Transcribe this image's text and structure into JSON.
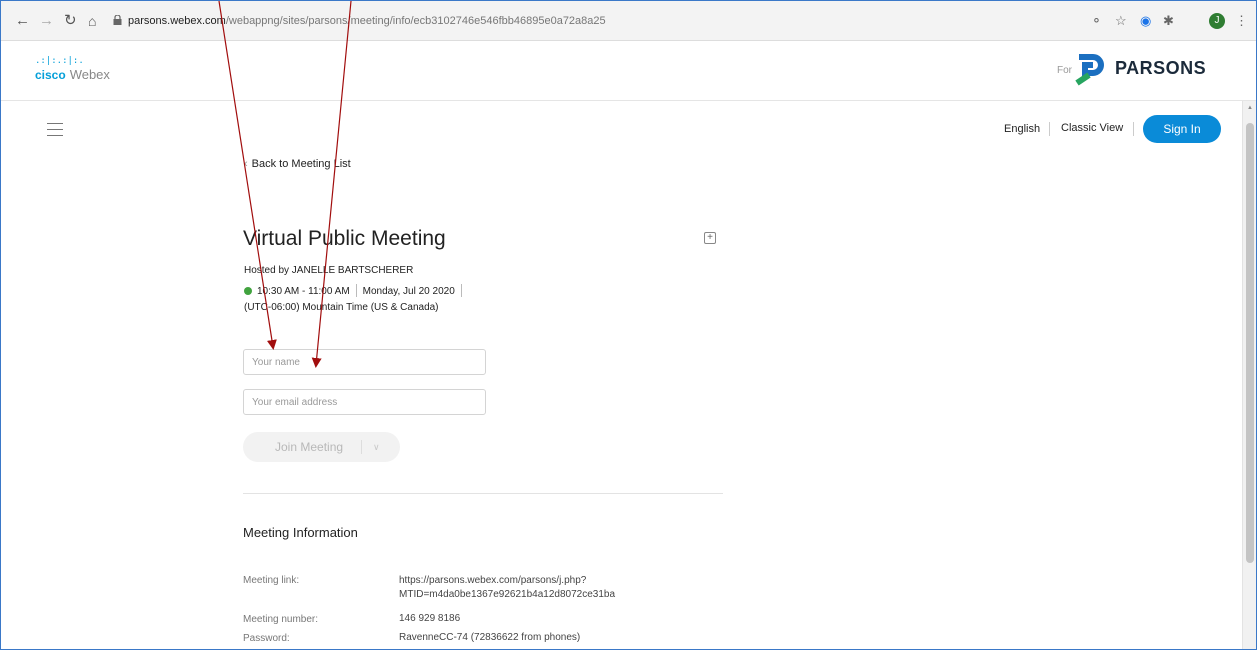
{
  "browser": {
    "url_host": "parsons.webex.com",
    "url_path": "/webappng/sites/parsons/meeting/info/ecb3102746e546fbb46895e0a72a8a25",
    "avatar_initial": "J"
  },
  "header": {
    "cisco_bars": ".:|:.:|:.",
    "cisco_word": "cisco",
    "webex_word": "Webex",
    "for_label": "For",
    "partner_name": "PARSONS"
  },
  "topbar": {
    "language": "English",
    "classic_view": "Classic View",
    "sign_in": "Sign In"
  },
  "back_link": "Back to Meeting List",
  "meeting": {
    "title": "Virtual Public Meeting",
    "hosted_by": "Hosted by JANELLE BARTSCHERER",
    "time_range": "10:30 AM - 11:00 AM",
    "date": "Monday, Jul 20 2020",
    "timezone": "(UTC-06:00) Mountain Time (US & Canada)"
  },
  "form": {
    "name_placeholder": "Your name",
    "email_placeholder": "Your email address",
    "join_label": "Join Meeting"
  },
  "meeting_info": {
    "heading": "Meeting Information",
    "link_label": "Meeting link:",
    "link_line1": "https://parsons.webex.com/parsons/j.php?",
    "link_line2": "MTID=m4da0be1367e92621b4a12d8072ce31ba",
    "number_label": "Meeting number:",
    "number_value": "146 929 8186",
    "password_label": "Password:",
    "password_value": "RavenneCC-74 (72836622 from phones)"
  },
  "colors": {
    "accent": "#0a8bd8",
    "cisco_blue": "#049fd9",
    "status_green": "#41a33f",
    "annotation_red": "#a10d0d"
  }
}
